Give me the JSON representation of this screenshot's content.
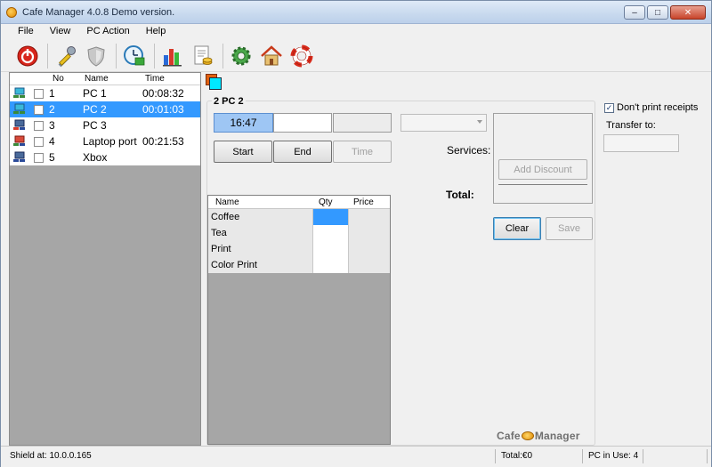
{
  "window": {
    "title": "Cafe Manager 4.0.8 Demo version.",
    "min_label": "–",
    "max_label": "□",
    "close_label": "✕"
  },
  "menu": {
    "items": [
      "File",
      "View",
      "PC Action",
      "Help"
    ]
  },
  "toolbar": {
    "buttons": [
      {
        "icon": "power-icon"
      },
      {
        "icon": "tools-icon"
      },
      {
        "icon": "shield-icon"
      },
      {
        "icon": "clock-icon"
      },
      {
        "icon": "bar-chart-icon"
      },
      {
        "icon": "report-icon"
      },
      {
        "icon": "settings-gear-icon"
      },
      {
        "icon": "home-icon"
      },
      {
        "icon": "lifebuoy-icon"
      }
    ]
  },
  "pc_list": {
    "columns": {
      "no": "No",
      "name": "Name",
      "time": "Time"
    },
    "rows": [
      {
        "no": "1",
        "name": "PC 1",
        "time": "00:08:32",
        "selected": false
      },
      {
        "no": "2",
        "name": "PC 2",
        "time": "00:01:03",
        "selected": true
      },
      {
        "no": "3",
        "name": "PC 3",
        "time": "",
        "selected": false
      },
      {
        "no": "4",
        "name": "Laptop port",
        "time": "00:21:53",
        "selected": false
      },
      {
        "no": "5",
        "name": "Xbox",
        "time": "",
        "selected": false
      }
    ]
  },
  "session": {
    "title": "2 PC 2",
    "start_time": "16:47",
    "end_time": "",
    "duration": "",
    "start_label": "Start",
    "end_label": "End",
    "time_label": "Time"
  },
  "items": {
    "columns": {
      "name": "Name",
      "qty": "Qty",
      "price": "Price"
    },
    "rows": [
      {
        "name": "Coffee",
        "qty": "",
        "price": ""
      },
      {
        "name": "Tea",
        "qty": "",
        "price": ""
      },
      {
        "name": "Print",
        "qty": "",
        "price": ""
      },
      {
        "name": "Color Print",
        "qty": "",
        "price": ""
      }
    ]
  },
  "billing": {
    "services_label": "Services:",
    "total_label": "Total:",
    "add_discount_label": "Add Discount",
    "clear_label": "Clear",
    "save_label": "Save"
  },
  "options": {
    "dont_print_label": "Don't print receipts",
    "dont_print_checked": true,
    "check_mark": "✓",
    "transfer_label": "Transfer to:",
    "transfer_value": ""
  },
  "brand": {
    "left": "Cafe",
    "right": "Manager"
  },
  "status": {
    "shield": "Shield at: 10.0.0.165",
    "total": "Total:€0",
    "pc_in_use": "PC in Use: 4"
  },
  "colors": {
    "accent": "#3399ff",
    "selected_row": "#3399ff",
    "time_highlight": "#9ec6f4",
    "swatch_front": "#00e8ff",
    "swatch_back": "#e06010"
  }
}
